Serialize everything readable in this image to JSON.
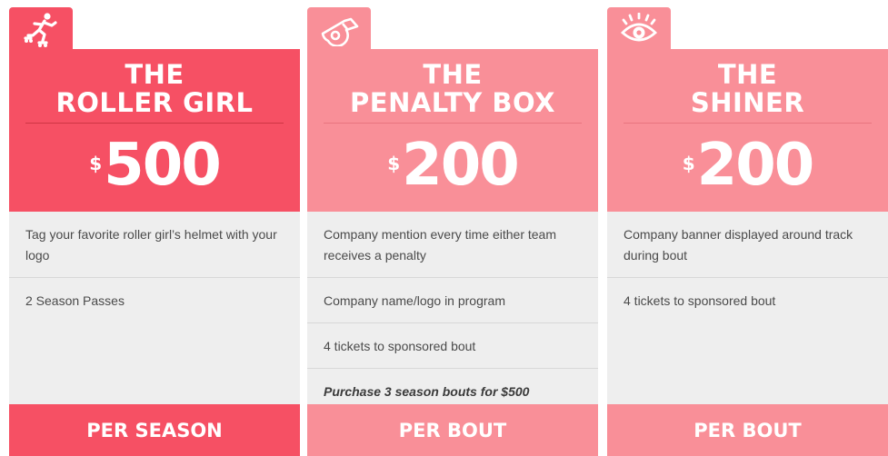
{
  "colors": {
    "primary": "#f65064",
    "secondary": "#f98f98",
    "body_bg": "#eeeeee"
  },
  "cards": [
    {
      "icon": "roller-skater-icon",
      "title_line1": "THE",
      "title_line2": "ROLLER GIRL",
      "currency": "$",
      "price": "500",
      "features": [
        "Tag your favorite roller girl’s helmet with your logo",
        "2 Season Passes"
      ],
      "footer": "PER SEASON"
    },
    {
      "icon": "whistle-icon",
      "title_line1": "THE",
      "title_line2": "PENALTY BOX",
      "currency": "$",
      "price": "200",
      "features": [
        "Company mention every time either team receives a penalty",
        "Company name/logo in program",
        "4 tickets to sponsored bout",
        "Purchase 3 season bouts for $500"
      ],
      "footer": "PER BOUT"
    },
    {
      "icon": "eye-icon",
      "title_line1": "THE",
      "title_line2": "SHINER",
      "currency": "$",
      "price": "200",
      "features": [
        "Company banner displayed around track during bout",
        "4 tickets to sponsored bout"
      ],
      "footer": "PER BOUT"
    }
  ]
}
